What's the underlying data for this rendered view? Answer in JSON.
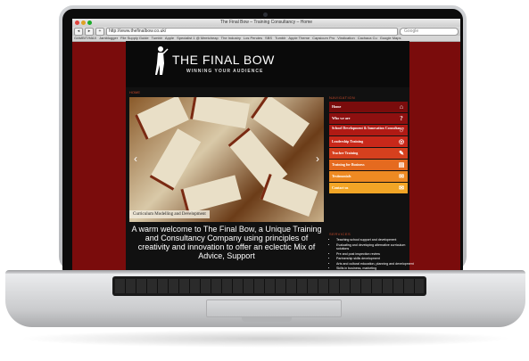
{
  "browser": {
    "window_title": "The Final Bow – Training Consultancy – Home",
    "url": "http://www.thefinalbow.co.uk/",
    "search_placeholder": "Google",
    "bookmarks": [
      "GAMBIT/MAX",
      "Jamblogger",
      "File Supply Guide",
      "Tumblr",
      "Apple",
      "Specialist 1 @ Meetcheap",
      "The Industry",
      "Los Pendes",
      "SBS",
      "Tumblr",
      "Apple Theme",
      "Capsicum Pro",
      "Vindication",
      "Cachaca Cu",
      "Google Maps"
    ]
  },
  "site": {
    "logo_title": "THE FINAL BOW",
    "logo_subtitle": "WINNING YOUR AUDIENCE",
    "breadcrumb": "HOME",
    "slide_caption": "Curriculum Modelling and Development",
    "welcome_text": "A warm welcome to The Final Bow, a Unique Training and Consultancy Company using principles of creativity and innovation to offer an eclectic Mix of Advice, Support",
    "navigation_title": "NAVIGATION",
    "nav_items": [
      {
        "label": "Home",
        "icon": "home-icon",
        "color": "#7a0c0c"
      },
      {
        "label": "Who we are",
        "icon": "question-icon",
        "color": "#8e1010"
      },
      {
        "label": "School Development & Innovation Consultancy",
        "icon": "lightbulb-icon",
        "color": "#b01a14"
      },
      {
        "label": "Leadership Training",
        "icon": "globe-icon",
        "color": "#c8281a"
      },
      {
        "label": "Teacher Training",
        "icon": "pencil-icon",
        "color": "#d6401e"
      },
      {
        "label": "Training for Business",
        "icon": "chart-icon",
        "color": "#e56a1f"
      },
      {
        "label": "Testimonials",
        "icon": "speech-icon",
        "color": "#ee8a22"
      },
      {
        "label": "Contact us",
        "icon": "mail-icon",
        "color": "#f2a526"
      }
    ],
    "services_title": "SERVICES",
    "services": [
      "Teaching school support and development",
      "Evaluating and developing alternative curriculum solutions",
      "Pre and post inspection review",
      "Partnership skills development",
      "Arts and cultural education, planning and development",
      "Skills in business, marketing"
    ]
  },
  "colors": {
    "page_background": "#7a0c0c",
    "accent": "#c84a2a"
  }
}
